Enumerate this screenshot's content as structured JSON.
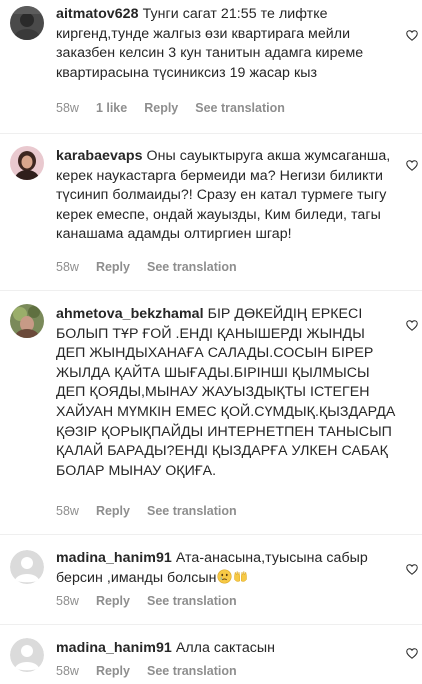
{
  "comments": [
    {
      "username": "aitmatov628",
      "text": "Тунги сагат 21:55 те лифтке киргенд,тунде жалгыз өзи квартирага мейли заказбен келсин 3 кун танитын адамга киреме квартирасына түсиниксиз 19 жасар кыз",
      "time": "58w",
      "likes": "1 like",
      "reply": "Reply",
      "see_translation": "See translation"
    },
    {
      "username": "karabaevaps",
      "text": "Оны сауыктыруга акша жумсаганша, керек наукастарга бермеиди ма? Негизи биликти түсинип болмаиды?! Сразу ен катал турмеге тыгу керек емеспе, ондай жауызды, Ким биледи, тагы канашама адамды олтиргиен шгар!",
      "time": "58w",
      "reply": "Reply",
      "see_translation": "See translation"
    },
    {
      "username": "ahmetova_bekzhamal",
      "text": "БІР ДӨКЕЙДІҢ ЕРКЕСІ БОЛЫП ТҰР ҒОЙ .ЕНДІ ҚАНЫШЕРДІ ЖЫНДЫ ДЕП ЖЫНДЫХАНАҒА САЛАДЫ.СОСЫН БІРЕР ЖЫЛДА ҚАЙТА ШЫҒАДЫ.БІРІНШІ ҚЫЛМЫСЫ ДЕП ҚОЯДЫ,МЫНАУ ЖАУЫЗДЫҚТЫ ІСТЕГЕН ХАЙУАН МҮМКІН ЕМЕС ҚОЙ.СҮМДЫҚ.ҚЫЗДАРДА ҚӘЗІР ҚОРЫҚПАЙДЫ ИНТЕРНЕТПЕН ТАНЫСЫП ҚАЛАЙ БАРАДЫ?ЕНДІ ҚЫЗДАРҒА УЛКЕН САБАҚ БОЛАР МЫНАУ ОҚИҒА.",
      "time": "58w",
      "reply": "Reply",
      "see_translation": "See translation"
    },
    {
      "username": "madina_hanim91",
      "text": "Ата-анасына,туысына сабыр берсин ,иманды болсын",
      "emojis": [
        "crying-face-emoji",
        "open-hands-emoji"
      ],
      "time": "58w",
      "reply": "Reply",
      "see_translation": "See translation"
    },
    {
      "username": "madina_hanim91",
      "text": "Алла сактасын",
      "time": "58w",
      "reply": "Reply",
      "see_translation": "See translation"
    }
  ],
  "colors": {
    "text": "#262626",
    "meta": "#8e8e8e",
    "avatar_placeholder": "#dbdbdb"
  }
}
